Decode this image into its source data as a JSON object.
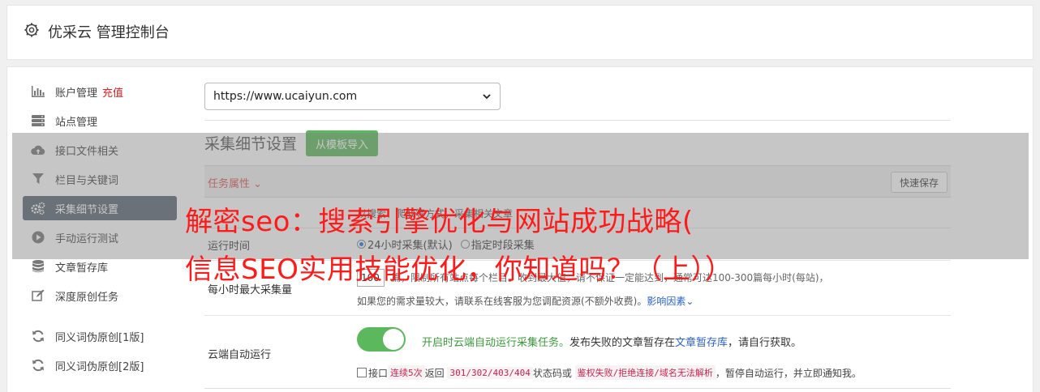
{
  "app": {
    "title": "优采云 管理控制台"
  },
  "sidebar": {
    "items": [
      {
        "label": "账户管理",
        "tag": "充值",
        "icon": "bar-chart-icon"
      },
      {
        "label": "站点管理",
        "icon": "server-icon"
      },
      {
        "label": "接口文件相关",
        "icon": "cloud-upload-icon"
      },
      {
        "label": "栏目与关键词",
        "icon": "filter-icon"
      },
      {
        "label": "采集细节设置",
        "icon": "gears-icon",
        "active": true
      },
      {
        "label": "手动运行测试",
        "icon": "play-circle-icon"
      },
      {
        "label": "文章暂存库",
        "icon": "database-icon"
      },
      {
        "label": "深度原创任务",
        "icon": "edit-icon"
      },
      {
        "label": "同义词伪原创[1版]",
        "icon": "refresh-icon"
      },
      {
        "label": "同义词伪原创[2版]",
        "icon": "refresh-icon"
      }
    ]
  },
  "site_select": {
    "value": "https://www.ucaiyun.com"
  },
  "section": {
    "title": "采集细节设置",
    "import_button": "从模板导入"
  },
  "props": {
    "label": "任务属性",
    "save_button": "快速保存"
  },
  "sources_row": {
    "text": "以搜索、爬取等方式，采集相关文章"
  },
  "runtime_row": {
    "label": "运行时间",
    "option1": "24小时采集(默认)",
    "option2": "指定时段采集"
  },
  "max_row": {
    "label": "每小时最大采集量",
    "value": "100",
    "line1": "篇，限制所有站点每个栏目。收到最大值，请不保证一定能达到，通常可达100-300篇每小时(每站)，",
    "line2": "如果您的需求量较大，请联系在线客服为您调配资源(不额外收费)。",
    "link": "影响因素"
  },
  "cloud_row": {
    "label": "云端自动运行",
    "green_text": "开启时云端自动运行采集任务。",
    "text_a": "发布失败的文章暂存在",
    "link": "文章暂存库",
    "text_b": "，请自行获取。",
    "l2_a": "接口",
    "l2_code1": "连续5次",
    "l2_b": "返回",
    "l2_code2": "301/302/403/404",
    "l2_c": "状态码或",
    "l2_code3": "鉴权失败/拒绝连接/域名无法解析",
    "l2_d": "，暂停自动运行，并立即通知我。"
  },
  "overlay": {
    "line1": "解密seo：搜索引擎优化与网站成功战略(",
    "line2": "信息SEO实用技能优化，你知道吗？（上））"
  },
  "colors": {
    "accent_green": "#5cb85c",
    "active_bg": "#5a6471",
    "headline_red": "#ff1a1a"
  }
}
